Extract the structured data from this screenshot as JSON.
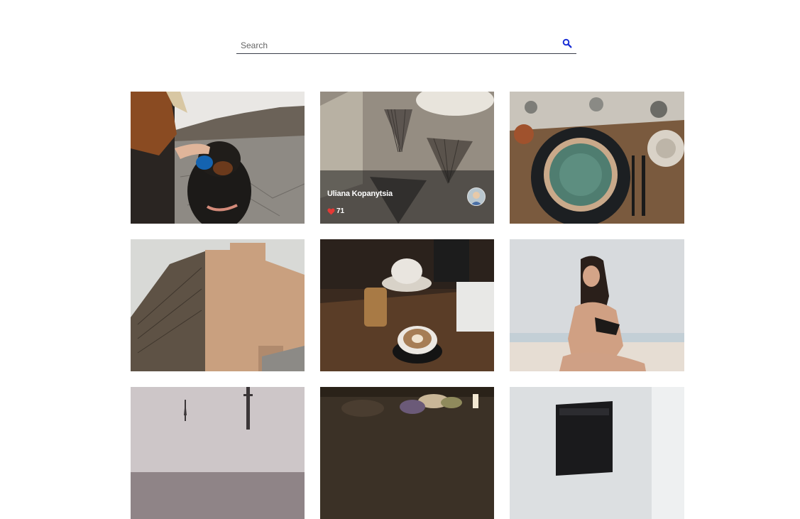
{
  "search": {
    "placeholder": "Search",
    "icon": "search-icon",
    "icon_color": "#1a2fd6"
  },
  "gallery": {
    "items": [
      {
        "subject": "dog-photo"
      },
      {
        "subject": "paper-fans-photo",
        "author": "Uliana Kopanytsia",
        "likes": "71"
      },
      {
        "subject": "table-setting-photo"
      },
      {
        "subject": "building-mural-photo"
      },
      {
        "subject": "coffee-table-photo"
      },
      {
        "subject": "beach-woman-photo"
      },
      {
        "subject": "tower-photo"
      },
      {
        "subject": "tea-table-photo"
      },
      {
        "subject": "laptop-photo"
      }
    ]
  },
  "colors": {
    "like_heart": "#e53935",
    "overlay": "rgba(30,30,30,0.55)"
  }
}
